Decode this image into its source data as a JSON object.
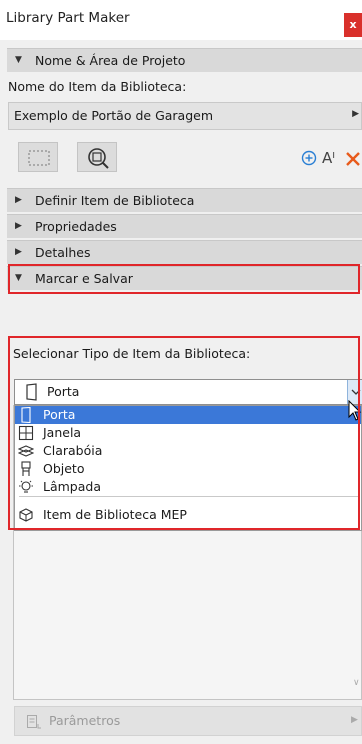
{
  "window": {
    "title": "Library Part Maker",
    "close_label": "x"
  },
  "sections": {
    "nome_area": "Nome & Área de Projeto",
    "definir": "Definir Item de Biblioteca",
    "propriedades": "Propriedades",
    "detalhes": "Detalhes",
    "marcar_salvar": "Marcar e Salvar"
  },
  "nome_area": {
    "field_label": "Nome do Item da Biblioteca:",
    "item_name": "Exemplo de Portão de Garagem"
  },
  "toolbar": {
    "text_size_glyph": "Aᴵ"
  },
  "marcar_salvar": {
    "field_label": "Selecionar Tipo de Item da Biblioteca:",
    "selected_type": "Porta",
    "options": [
      {
        "label": "Porta",
        "icon": "door-icon"
      },
      {
        "label": "Janela",
        "icon": "window-icon"
      },
      {
        "label": "Clarabóia",
        "icon": "skylight-icon"
      },
      {
        "label": "Objeto",
        "icon": "object-icon"
      },
      {
        "label": "Lâmpada",
        "icon": "lamp-icon"
      },
      {
        "label": "Item de Biblioteca MEP",
        "icon": "mep-icon"
      }
    ]
  },
  "footer": {
    "parametros_label": "Parâmetros"
  },
  "colors": {
    "accent_red": "#e0262a",
    "selection_blue": "#3b78d8",
    "close_red": "#d9302b",
    "add_icon_blue": "#2a7fd4"
  }
}
